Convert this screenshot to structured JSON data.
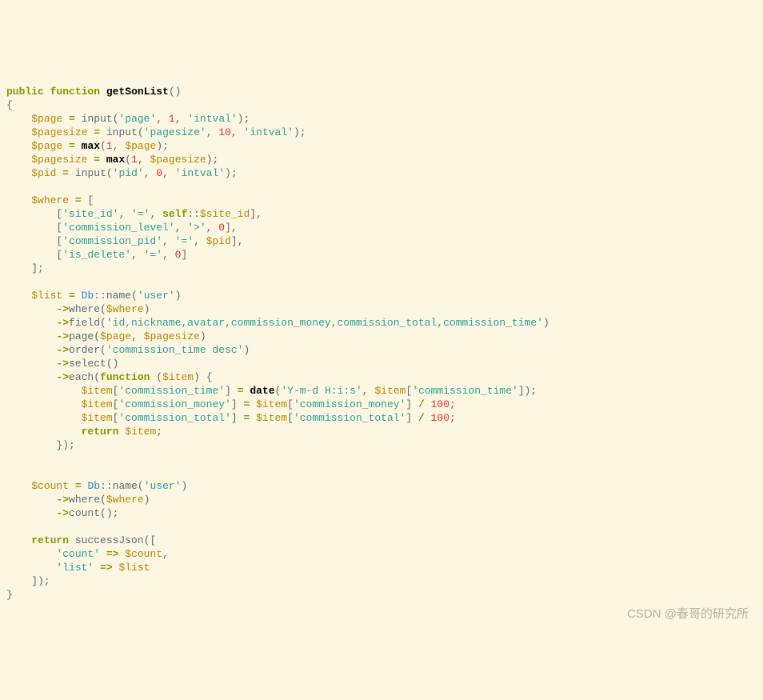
{
  "watermark": "CSDN @春哥的研究所",
  "tokens": [
    {
      "t": "public",
      "c": "kw"
    },
    {
      "t": " "
    },
    {
      "t": "function",
      "c": "kw"
    },
    {
      "t": " "
    },
    {
      "t": "getSonList",
      "c": "fn"
    },
    {
      "t": "()"
    },
    {
      "nl": 1
    },
    {
      "t": "{"
    },
    {
      "nl": 1
    },
    {
      "t": "    "
    },
    {
      "t": "$page",
      "c": "var"
    },
    {
      "t": " "
    },
    {
      "t": "=",
      "c": "op"
    },
    {
      "t": " input("
    },
    {
      "t": "'page'",
      "c": "str"
    },
    {
      "t": ", "
    },
    {
      "t": "1",
      "c": "num"
    },
    {
      "t": ", "
    },
    {
      "t": "'intval'",
      "c": "str"
    },
    {
      "t": ");"
    },
    {
      "nl": 1
    },
    {
      "t": "    "
    },
    {
      "t": "$pagesize",
      "c": "var"
    },
    {
      "t": " "
    },
    {
      "t": "=",
      "c": "op"
    },
    {
      "t": " input("
    },
    {
      "t": "'pagesize'",
      "c": "str"
    },
    {
      "t": ", "
    },
    {
      "t": "10",
      "c": "num"
    },
    {
      "t": ", "
    },
    {
      "t": "'intval'",
      "c": "str"
    },
    {
      "t": ");"
    },
    {
      "nl": 1
    },
    {
      "t": "    "
    },
    {
      "t": "$page",
      "c": "var"
    },
    {
      "t": " "
    },
    {
      "t": "=",
      "c": "op"
    },
    {
      "t": " "
    },
    {
      "t": "max",
      "c": "fn"
    },
    {
      "t": "("
    },
    {
      "t": "1",
      "c": "num"
    },
    {
      "t": ", "
    },
    {
      "t": "$page",
      "c": "var"
    },
    {
      "t": ");"
    },
    {
      "nl": 1
    },
    {
      "t": "    "
    },
    {
      "t": "$pagesize",
      "c": "var"
    },
    {
      "t": " "
    },
    {
      "t": "=",
      "c": "op"
    },
    {
      "t": " "
    },
    {
      "t": "max",
      "c": "fn"
    },
    {
      "t": "("
    },
    {
      "t": "1",
      "c": "num"
    },
    {
      "t": ", "
    },
    {
      "t": "$pagesize",
      "c": "var"
    },
    {
      "t": ");"
    },
    {
      "nl": 1
    },
    {
      "t": "    "
    },
    {
      "t": "$pid",
      "c": "var"
    },
    {
      "t": " "
    },
    {
      "t": "=",
      "c": "op"
    },
    {
      "t": " input("
    },
    {
      "t": "'pid'",
      "c": "str"
    },
    {
      "t": ", "
    },
    {
      "t": "0",
      "c": "num"
    },
    {
      "t": ", "
    },
    {
      "t": "'intval'",
      "c": "str"
    },
    {
      "t": ");"
    },
    {
      "nl": 1
    },
    {
      "nl": 1
    },
    {
      "t": "    "
    },
    {
      "t": "$where",
      "c": "var"
    },
    {
      "t": " "
    },
    {
      "t": "=",
      "c": "op"
    },
    {
      "t": " ["
    },
    {
      "nl": 1
    },
    {
      "t": "        ["
    },
    {
      "t": "'site_id'",
      "c": "str"
    },
    {
      "t": ", "
    },
    {
      "t": "'='",
      "c": "str"
    },
    {
      "t": ", "
    },
    {
      "t": "self",
      "c": "kw"
    },
    {
      "t": "::"
    },
    {
      "t": "$site_id",
      "c": "var"
    },
    {
      "t": "],"
    },
    {
      "nl": 1
    },
    {
      "t": "        ["
    },
    {
      "t": "'commission_level'",
      "c": "str"
    },
    {
      "t": ", "
    },
    {
      "t": "'>'",
      "c": "str"
    },
    {
      "t": ", "
    },
    {
      "t": "0",
      "c": "num"
    },
    {
      "t": "],"
    },
    {
      "nl": 1
    },
    {
      "t": "        ["
    },
    {
      "t": "'commission_pid'",
      "c": "str"
    },
    {
      "t": ", "
    },
    {
      "t": "'='",
      "c": "str"
    },
    {
      "t": ", "
    },
    {
      "t": "$pid",
      "c": "var"
    },
    {
      "t": "],"
    },
    {
      "nl": 1
    },
    {
      "t": "        ["
    },
    {
      "t": "'is_delete'",
      "c": "str"
    },
    {
      "t": ", "
    },
    {
      "t": "'='",
      "c": "str"
    },
    {
      "t": ", "
    },
    {
      "t": "0",
      "c": "num"
    },
    {
      "t": "]"
    },
    {
      "nl": 1
    },
    {
      "t": "    ];"
    },
    {
      "nl": 1
    },
    {
      "nl": 1
    },
    {
      "t": "    "
    },
    {
      "t": "$list",
      "c": "var"
    },
    {
      "t": " "
    },
    {
      "t": "=",
      "c": "op"
    },
    {
      "t": " "
    },
    {
      "t": "Db",
      "c": "cls"
    },
    {
      "t": "::name("
    },
    {
      "t": "'user'",
      "c": "str"
    },
    {
      "t": ")"
    },
    {
      "nl": 1
    },
    {
      "t": "        "
    },
    {
      "t": "->",
      "c": "op"
    },
    {
      "t": "where("
    },
    {
      "t": "$where",
      "c": "var"
    },
    {
      "t": ")"
    },
    {
      "nl": 1
    },
    {
      "t": "        "
    },
    {
      "t": "->",
      "c": "op"
    },
    {
      "t": "field("
    },
    {
      "t": "'id,nickname,avatar,commission_money,commission_total,commission_time'",
      "c": "str"
    },
    {
      "t": ")"
    },
    {
      "nl": 1
    },
    {
      "t": "        "
    },
    {
      "t": "->",
      "c": "op"
    },
    {
      "t": "page("
    },
    {
      "t": "$page",
      "c": "var"
    },
    {
      "t": ", "
    },
    {
      "t": "$pagesize",
      "c": "var"
    },
    {
      "t": ")"
    },
    {
      "nl": 1
    },
    {
      "t": "        "
    },
    {
      "t": "->",
      "c": "op"
    },
    {
      "t": "order("
    },
    {
      "t": "'commission_time desc'",
      "c": "str"
    },
    {
      "t": ")"
    },
    {
      "nl": 1
    },
    {
      "t": "        "
    },
    {
      "t": "->",
      "c": "op"
    },
    {
      "t": "select()"
    },
    {
      "nl": 1
    },
    {
      "t": "        "
    },
    {
      "t": "->",
      "c": "op"
    },
    {
      "t": "each("
    },
    {
      "t": "function",
      "c": "kw"
    },
    {
      "t": " ("
    },
    {
      "t": "$item",
      "c": "var"
    },
    {
      "t": ") {"
    },
    {
      "nl": 1
    },
    {
      "t": "            "
    },
    {
      "t": "$item",
      "c": "var"
    },
    {
      "t": "["
    },
    {
      "t": "'commission_time'",
      "c": "str"
    },
    {
      "t": "] "
    },
    {
      "t": "=",
      "c": "op"
    },
    {
      "t": " "
    },
    {
      "t": "date",
      "c": "fn"
    },
    {
      "t": "("
    },
    {
      "t": "'Y-m-d H:i:s'",
      "c": "str"
    },
    {
      "t": ", "
    },
    {
      "t": "$item",
      "c": "var"
    },
    {
      "t": "["
    },
    {
      "t": "'commission_time'",
      "c": "str"
    },
    {
      "t": "]);"
    },
    {
      "nl": 1
    },
    {
      "t": "            "
    },
    {
      "t": "$item",
      "c": "var"
    },
    {
      "t": "["
    },
    {
      "t": "'commission_money'",
      "c": "str"
    },
    {
      "t": "] "
    },
    {
      "t": "=",
      "c": "op"
    },
    {
      "t": " "
    },
    {
      "t": "$item",
      "c": "var"
    },
    {
      "t": "["
    },
    {
      "t": "'commission_money'",
      "c": "str"
    },
    {
      "t": "] "
    },
    {
      "t": "/",
      "c": "op"
    },
    {
      "t": " "
    },
    {
      "t": "100",
      "c": "num"
    },
    {
      "t": ";"
    },
    {
      "nl": 1
    },
    {
      "t": "            "
    },
    {
      "t": "$item",
      "c": "var"
    },
    {
      "t": "["
    },
    {
      "t": "'commission_total'",
      "c": "str"
    },
    {
      "t": "] "
    },
    {
      "t": "=",
      "c": "op"
    },
    {
      "t": " "
    },
    {
      "t": "$item",
      "c": "var"
    },
    {
      "t": "["
    },
    {
      "t": "'commission_total'",
      "c": "str"
    },
    {
      "t": "] "
    },
    {
      "t": "/",
      "c": "op"
    },
    {
      "t": " "
    },
    {
      "t": "100",
      "c": "num"
    },
    {
      "t": ";"
    },
    {
      "nl": 1
    },
    {
      "t": "            "
    },
    {
      "t": "return",
      "c": "kw"
    },
    {
      "t": " "
    },
    {
      "t": "$item",
      "c": "var"
    },
    {
      "t": ";"
    },
    {
      "nl": 1
    },
    {
      "t": "        });"
    },
    {
      "nl": 1
    },
    {
      "nl": 1
    },
    {
      "nl": 1
    },
    {
      "t": "    "
    },
    {
      "t": "$count",
      "c": "var"
    },
    {
      "t": " "
    },
    {
      "t": "=",
      "c": "op"
    },
    {
      "t": " "
    },
    {
      "t": "Db",
      "c": "cls"
    },
    {
      "t": "::name("
    },
    {
      "t": "'user'",
      "c": "str"
    },
    {
      "t": ")"
    },
    {
      "nl": 1
    },
    {
      "t": "        "
    },
    {
      "t": "->",
      "c": "op"
    },
    {
      "t": "where("
    },
    {
      "t": "$where",
      "c": "var"
    },
    {
      "t": ")"
    },
    {
      "nl": 1
    },
    {
      "t": "        "
    },
    {
      "t": "->",
      "c": "op"
    },
    {
      "t": "count();"
    },
    {
      "nl": 1
    },
    {
      "nl": 1
    },
    {
      "t": "    "
    },
    {
      "t": "return",
      "c": "kw"
    },
    {
      "t": " successJson(["
    },
    {
      "nl": 1
    },
    {
      "t": "        "
    },
    {
      "t": "'count'",
      "c": "str"
    },
    {
      "t": " "
    },
    {
      "t": "=>",
      "c": "op"
    },
    {
      "t": " "
    },
    {
      "t": "$count",
      "c": "var"
    },
    {
      "t": ","
    },
    {
      "nl": 1
    },
    {
      "t": "        "
    },
    {
      "t": "'list'",
      "c": "str"
    },
    {
      "t": " "
    },
    {
      "t": "=>",
      "c": "op"
    },
    {
      "t": " "
    },
    {
      "t": "$list",
      "c": "var"
    },
    {
      "nl": 1
    },
    {
      "t": "    ]);"
    },
    {
      "nl": 1
    },
    {
      "t": "}"
    }
  ]
}
